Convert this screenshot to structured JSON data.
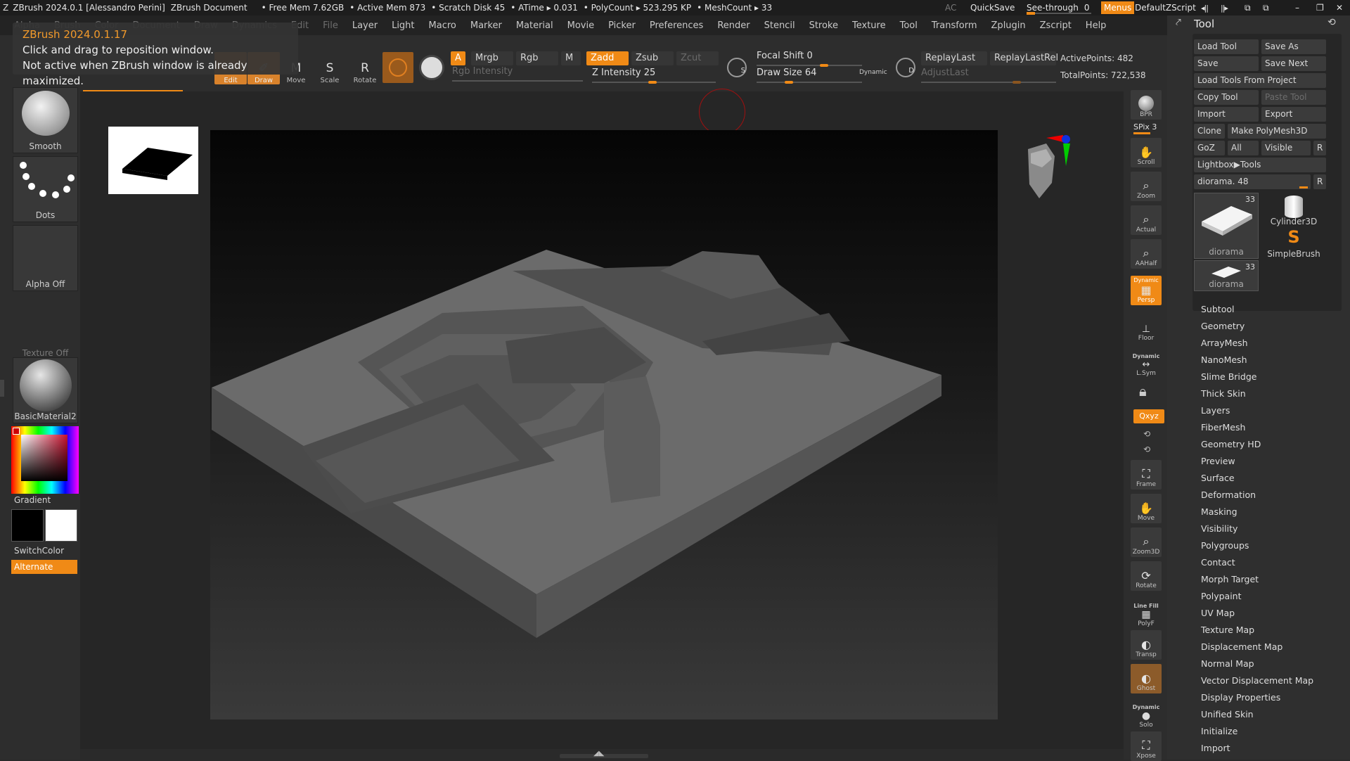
{
  "titlebar": {
    "app": "ZBrush 2024.0.1 [Alessandro Perini]",
    "doc": "ZBrush Document",
    "free_mem": "• Free Mem 7.62GB",
    "active_mem": "• Active Mem 873",
    "scratch": "• Scratch Disk 45",
    "atime": "• ATime ▸ 0.031",
    "polycount": "• PolyCount ▸ 523.295 KP",
    "meshcount": "• MeshCount ▸ 33",
    "ac": "AC",
    "quicksave": "QuickSave",
    "seethrough": "See-through",
    "seethrough_val": "0",
    "menus": "Menus",
    "zscript": "DefaultZScript"
  },
  "menu": [
    "Alpha",
    "Brush",
    "Color",
    "Document",
    "Draw",
    "Dynamics",
    "Edit",
    "File",
    "Layer",
    "Light",
    "Macro",
    "Marker",
    "Material",
    "Movie",
    "Picker",
    "Preferences",
    "Render",
    "Stencil",
    "Stroke",
    "Texture",
    "Tool",
    "Transform",
    "Zplugin",
    "Zscript",
    "Help"
  ],
  "tooltip": {
    "title": "ZBrush 2024.0.1.17",
    "line1": "Click and drag to reposition window.",
    "line2": "Not active when ZBrush window is already maximized."
  },
  "toolbar": {
    "edit": "Edit",
    "draw": "Draw",
    "move": "Move",
    "scale": "Scale",
    "rotate": "Rotate",
    "a": "A",
    "mrgb": "Mrgb",
    "rgb": "Rgb",
    "m": "M",
    "rgb_intensity": "Rgb Intensity",
    "zadd": "Zadd",
    "zsub": "Zsub",
    "zcut": "Zcut",
    "z_intensity": "Z Intensity 25",
    "focal_shift": "Focal Shift 0",
    "draw_size": "Draw Size 64",
    "dynamic": "Dynamic",
    "replay_last": "ReplayLast",
    "replay_last_rel": "ReplayLastRel",
    "adjust_last": "AdjustLast",
    "active_points": "ActivePoints: 482",
    "total_points": "TotalPoints: 722,538"
  },
  "left": {
    "smooth": "Smooth",
    "dots": "Dots",
    "alpha_off": "Alpha Off",
    "texture_off": "Texture Off",
    "material": "BasicMaterial2",
    "gradient": "Gradient",
    "switchcolor": "SwitchColor",
    "alternate": "Alternate"
  },
  "right_shelf": {
    "bpr": "BPR",
    "spix": "SPix 3",
    "scroll": "Scroll",
    "zoom": "Zoom",
    "actual": "Actual",
    "aahalf": "AAHalf",
    "dynamic": "Dynamic",
    "persp": "Persp",
    "floor": "Floor",
    "lsym": "L.Sym",
    "xyz": "Qxyz",
    "frame": "Frame",
    "move": "Move",
    "zoom3d": "Zoom3D",
    "rotate": "Rotate",
    "line_fill": "Line Fill",
    "polyf": "PolyF",
    "transp": "Transp",
    "ghost": "Ghost",
    "solo": "Solo",
    "xpose": "Xpose"
  },
  "tool": {
    "title": "Tool",
    "load_tool": "Load Tool",
    "save_as": "Save As",
    "save": "Save",
    "save_next": "Save Next",
    "load_from_project": "Load Tools From Project",
    "copy_tool": "Copy Tool",
    "paste_tool": "Paste Tool",
    "import": "Import",
    "export": "Export",
    "clone": "Clone",
    "make_polymesh": "Make PolyMesh3D",
    "goz": "GoZ",
    "all": "All",
    "visible": "Visible",
    "r": "R",
    "lightbox": "Lightbox▶Tools",
    "diorama_slider": "diorama. 48",
    "thumb_count": "33",
    "thumb_diorama": "diorama",
    "thumb_cylinder": "Cylinder3D",
    "thumb_simplebrush": "SimpleBrush",
    "thumb_diorama2": "diorama",
    "thumb_count2": "33",
    "subpalettes": [
      "Subtool",
      "Geometry",
      "ArrayMesh",
      "NanoMesh",
      "Slime Bridge",
      "Thick Skin",
      "Layers",
      "FiberMesh",
      "Geometry HD",
      "Preview",
      "Surface",
      "Deformation",
      "Masking",
      "Visibility",
      "Polygroups",
      "Contact",
      "Morph Target",
      "Polypaint",
      "UV Map",
      "Texture Map",
      "Displacement Map",
      "Normal Map",
      "Vector Displacement Map",
      "Display Properties",
      "Unified Skin",
      "Initialize",
      "Import"
    ]
  },
  "colors": {
    "accent": "#f08a16",
    "bg": "#2a2a2a"
  }
}
